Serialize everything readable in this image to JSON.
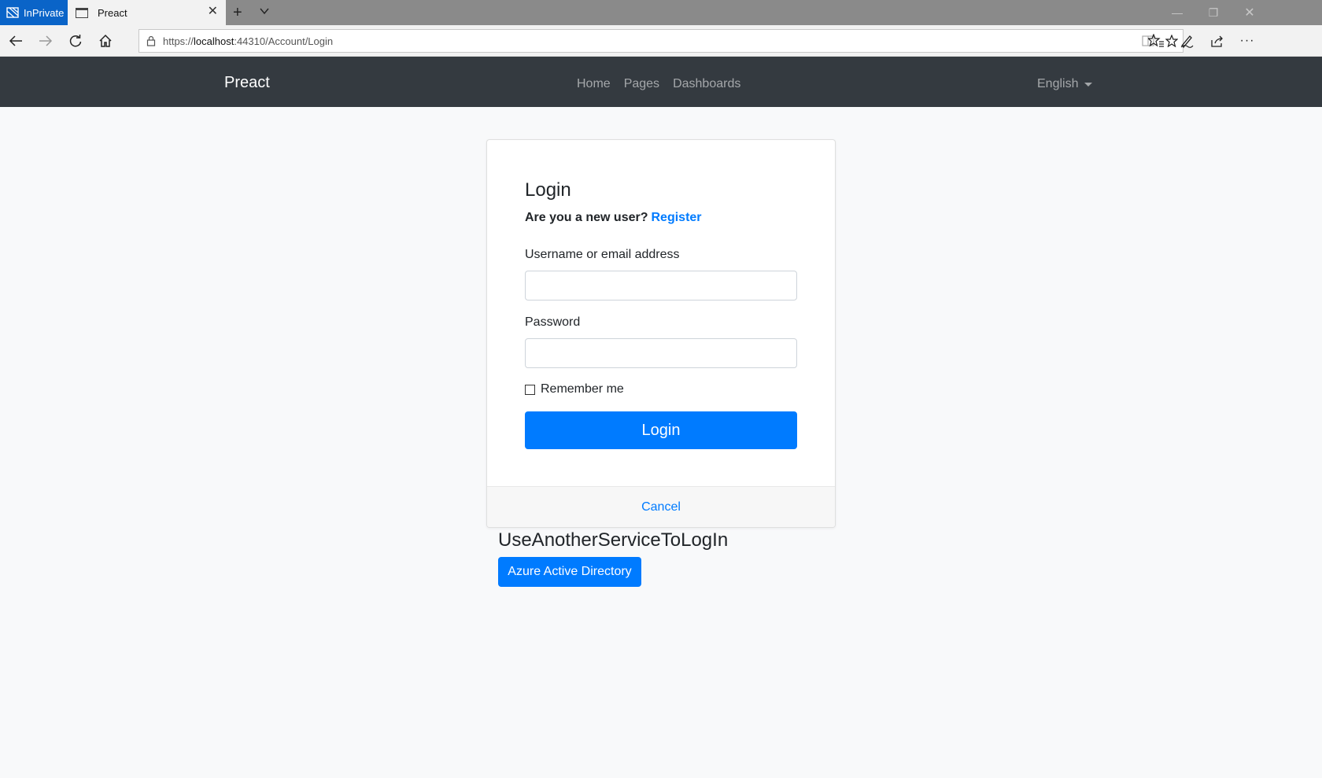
{
  "browser": {
    "inprivate_label": "InPrivate",
    "tab_title": "Preact",
    "url_scheme": "https://",
    "url_host": "localhost",
    "url_rest": ":44310/Account/Login"
  },
  "navbar": {
    "brand": "Preact",
    "links": [
      "Home",
      "Pages",
      "Dashboards"
    ],
    "language": "English"
  },
  "login": {
    "title": "Login",
    "new_user_prompt": "Are you a new user?",
    "register_link": "Register",
    "username_label": "Username or email address",
    "username_value": "",
    "password_label": "Password",
    "password_value": "",
    "remember_label": "Remember me",
    "remember_checked": false,
    "submit_label": "Login",
    "cancel_label": "Cancel"
  },
  "external": {
    "title": "UseAnotherServiceToLogIn",
    "azure_button": "Azure Active Directory"
  },
  "colors": {
    "primary": "#007bff",
    "navbar_bg": "#343a40",
    "inprivate_bg": "#0a64c8"
  }
}
